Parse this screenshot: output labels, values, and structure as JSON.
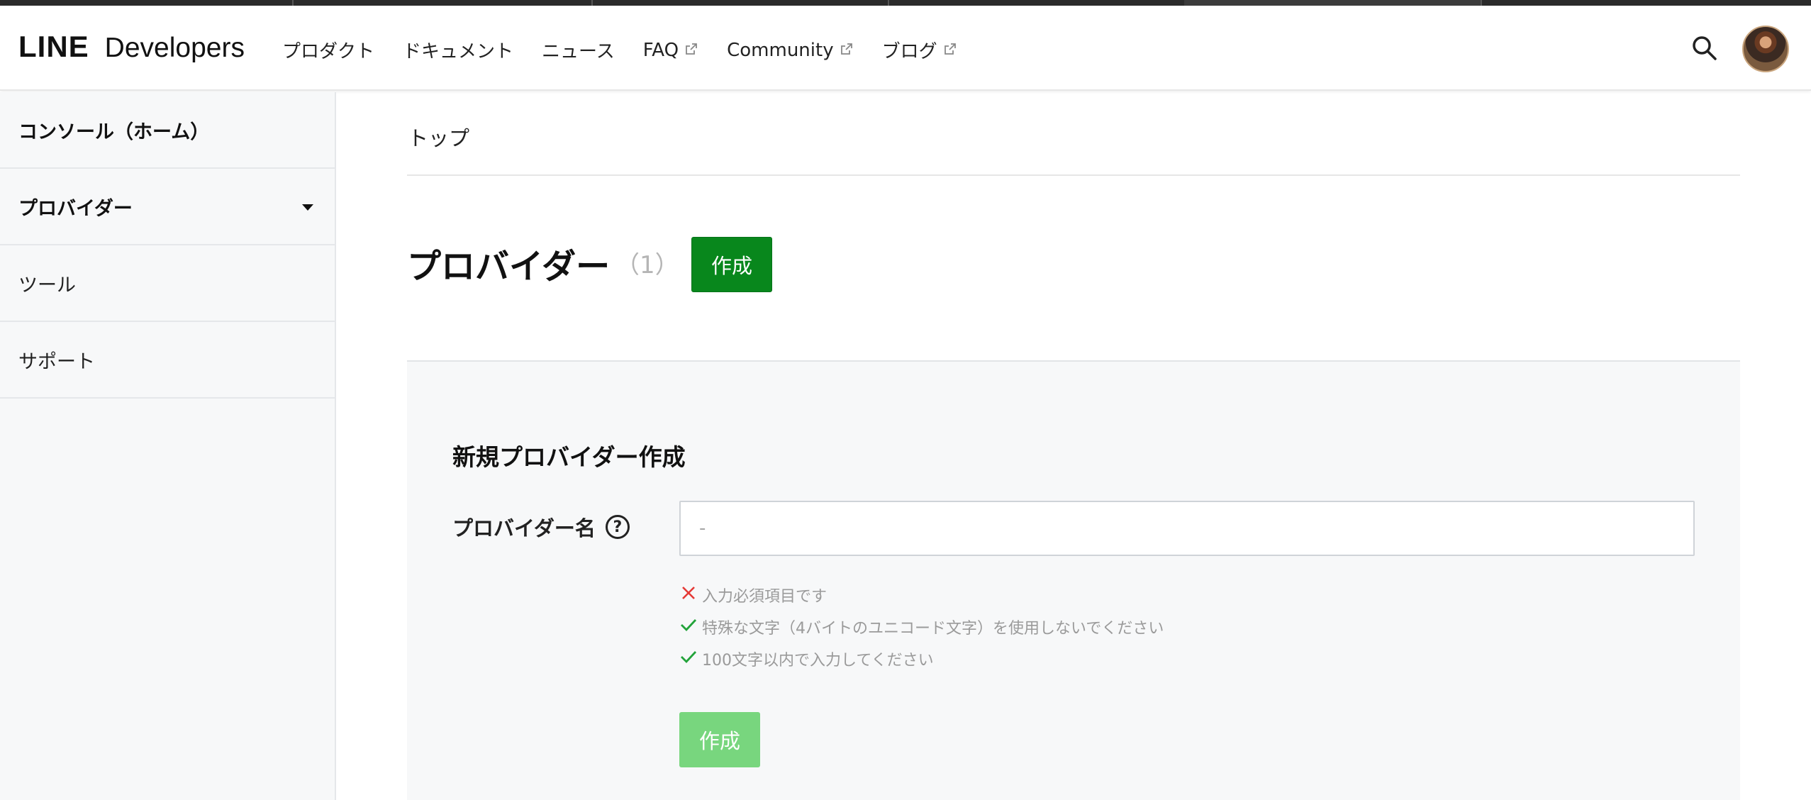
{
  "header": {
    "logo": {
      "line": "LINE",
      "developers": "Developers"
    },
    "nav": [
      {
        "label": "プロダクト",
        "external": false
      },
      {
        "label": "ドキュメント",
        "external": false
      },
      {
        "label": "ニュース",
        "external": false
      },
      {
        "label": "FAQ",
        "external": true
      },
      {
        "label": "Community",
        "external": true
      },
      {
        "label": "ブログ",
        "external": true
      }
    ],
    "search_icon": "search-icon",
    "avatar_icon": "user-avatar"
  },
  "sidebar": {
    "items": [
      {
        "label": "コンソール（ホーム）",
        "bold": true,
        "expandable": false
      },
      {
        "label": "プロバイダー",
        "bold": true,
        "expandable": true
      },
      {
        "label": "ツール",
        "bold": false,
        "expandable": false
      },
      {
        "label": "サポート",
        "bold": false,
        "expandable": false
      }
    ]
  },
  "main": {
    "breadcrumb": "トップ",
    "title": "プロバイダー",
    "count": "（1）",
    "create_label": "作成"
  },
  "form": {
    "title": "新規プロバイダー作成",
    "field_label": "プロバイダー名",
    "help_icon": "question-circle-icon",
    "input_value": "",
    "input_placeholder": "-",
    "rules": [
      {
        "text": "入力必須項目です",
        "status": "fail"
      },
      {
        "text": "特殊な文字（4バイトのユニコード文字）を使用しないでください",
        "status": "pass"
      },
      {
        "text": "100文字以内で入力してください",
        "status": "pass"
      }
    ],
    "submit_label": "作成"
  },
  "colors": {
    "primary_green": "#08871c",
    "disabled_green": "#78d67e",
    "fail_red": "#e53935",
    "pass_green": "#22a33a",
    "panel_bg": "#f7f8f9"
  }
}
